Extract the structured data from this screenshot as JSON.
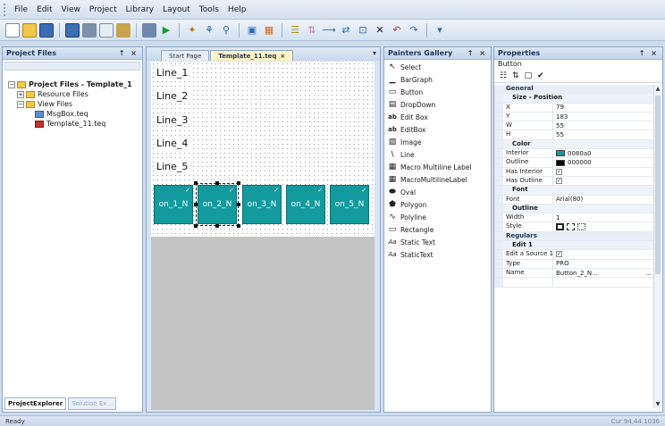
{
  "menu": [
    "File",
    "Edit",
    "View",
    "Project",
    "Library",
    "Layout",
    "Tools",
    "Help"
  ],
  "toolbar": {
    "icons": [
      "new-file-icon",
      "open-folder-icon",
      "save-icon",
      "save-all-icon",
      "print-icon",
      "copy-icon",
      "paste-icon",
      "run-icon",
      "build-icon",
      "debug-icon",
      "network-icon",
      "image-icon",
      "color-icon",
      "text-icon",
      "align-icon",
      "size-icon",
      "group-icon",
      "delete-icon",
      "undo-icon",
      "redo-icon"
    ]
  },
  "project_panel": {
    "title": "Project Files",
    "controls": "↑ ×",
    "tree": [
      {
        "label": "Project Files - Template_1",
        "level": 0,
        "expander": "−",
        "icon": "folder"
      },
      {
        "label": "Resource Files",
        "level": 1,
        "expander": "+",
        "icon": "folder"
      },
      {
        "label": "View Files",
        "level": 1,
        "expander": "−",
        "icon": "folder"
      },
      {
        "label": "MsgBox.teq",
        "level": 2,
        "expander": "",
        "icon": "file-blue"
      },
      {
        "label": "Template_11.teq",
        "level": 2,
        "expander": "",
        "icon": "file-red"
      }
    ],
    "tabs": [
      {
        "label": "ProjectExplorer",
        "active": true
      },
      {
        "label": "Solution Ex...",
        "active": false
      }
    ]
  },
  "editor": {
    "tabs": [
      {
        "label": "Start Page",
        "active": false
      },
      {
        "label": "Template_11.teq",
        "active": true,
        "close": "×"
      }
    ],
    "dropdown": "▾",
    "lines": [
      "Line_1",
      "Line_2",
      "Line_3",
      "Line_4",
      "Line_5"
    ],
    "buttons": [
      {
        "label": "on_1_N"
      },
      {
        "label": "on_2_N"
      },
      {
        "label": "on_3_N"
      },
      {
        "label": "on_4_N"
      },
      {
        "label": "on_5_N"
      }
    ],
    "selected_button_index": 1,
    "button_color": "#139a9d"
  },
  "palette": {
    "title": "Painters Gallery",
    "controls": "↑ ×",
    "items": [
      {
        "label": "Select",
        "icon": "↖"
      },
      {
        "label": "BarGraph",
        "icon": "▁"
      },
      {
        "label": "Button",
        "icon": "▭"
      },
      {
        "label": "DropDown",
        "icon": "▤"
      },
      {
        "label": "Edit Box",
        "icon": "ab"
      },
      {
        "label": "EditBox",
        "icon": "ab"
      },
      {
        "label": "Image",
        "icon": "▨"
      },
      {
        "label": "Line",
        "icon": "\\"
      },
      {
        "label": "Macro Multiline Label",
        "icon": "▦"
      },
      {
        "label": "MacroMultilineLabel",
        "icon": "▦"
      },
      {
        "label": "Oval",
        "icon": "⬬"
      },
      {
        "label": "Polygon",
        "icon": "⬟"
      },
      {
        "label": "Polyline",
        "icon": "∿"
      },
      {
        "label": "Rectangle",
        "icon": "▭"
      },
      {
        "label": "Static Text",
        "icon": "Aa"
      },
      {
        "label": "StaticText",
        "icon": "Aa"
      }
    ]
  },
  "properties": {
    "title": "Properties",
    "controls": "↑ ×",
    "object": "Button",
    "tools": [
      "☷",
      "⇅",
      "□",
      "✔"
    ],
    "rows": [
      {
        "kind": "cat",
        "name": "General"
      },
      {
        "kind": "sub",
        "name": "Size - Position"
      },
      {
        "kind": "row",
        "name": "X",
        "value": "79"
      },
      {
        "kind": "row",
        "name": "Y",
        "value": "183"
      },
      {
        "kind": "row",
        "name": "W",
        "value": "55"
      },
      {
        "kind": "row",
        "name": "H",
        "value": "55"
      },
      {
        "kind": "sub",
        "name": "Color"
      },
      {
        "kind": "row",
        "name": "Interior",
        "value": "0080a0",
        "swatch": "#139a9d"
      },
      {
        "kind": "row",
        "name": "Outline",
        "value": "000000",
        "swatch": "#000000"
      },
      {
        "kind": "row",
        "name": "Has Interior",
        "value": "",
        "check": "✓"
      },
      {
        "kind": "row",
        "name": "Has Outline",
        "value": "",
        "check": "✓"
      },
      {
        "kind": "sub",
        "name": "Font"
      },
      {
        "kind": "row",
        "name": "Font",
        "value": "Arial(80)"
      },
      {
        "kind": "sub",
        "name": "Outline"
      },
      {
        "kind": "row",
        "name": "Width",
        "value": "1"
      },
      {
        "kind": "row",
        "name": "Style",
        "value": "",
        "style": true
      },
      {
        "kind": "cat",
        "name": "Regulars"
      },
      {
        "kind": "sub",
        "name": "Edit 1"
      },
      {
        "kind": "row",
        "name": "Edit a Source 1",
        "value": "",
        "check": "✓"
      },
      {
        "kind": "row",
        "name": "Type",
        "value": "PRO"
      },
      {
        "kind": "row",
        "name": "Name",
        "value": "Button_2_N...",
        "extra": "…"
      },
      {
        "kind": "row",
        "name": "",
        "value": ""
      }
    ],
    "scroll_up": "▲",
    "scroll_down": "▼"
  },
  "status": {
    "left": "Ready",
    "right": "Cur 94,44 1036"
  }
}
